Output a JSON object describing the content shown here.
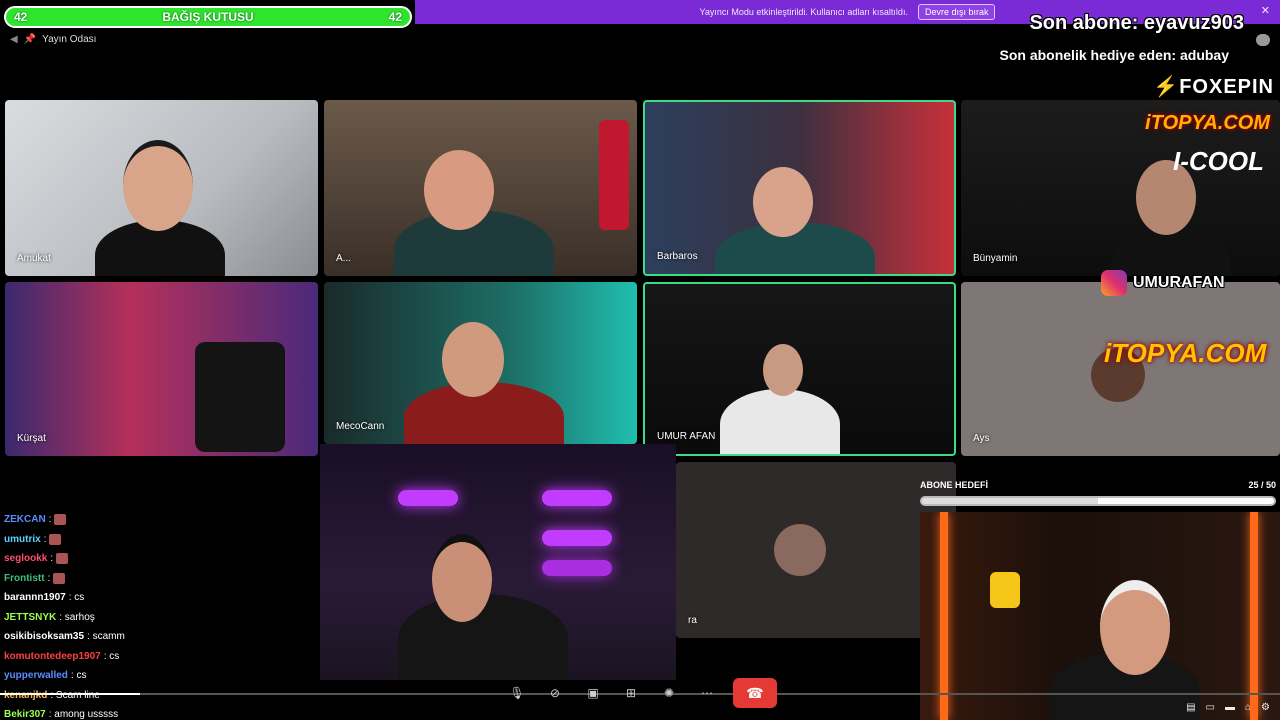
{
  "donation": {
    "left_count": "42",
    "title": "BAĞIŞ KUTUSU",
    "right_count": "42",
    "color": "#2ee52e"
  },
  "banner": {
    "message": "Yayıncı Modu etkinleştirildi. Kullanıcı adları kısaltıldı.",
    "button": "Devre dışı bırak",
    "close": "✕"
  },
  "room": {
    "title": "Yayın Odası",
    "pin_icon": "pin-icon"
  },
  "overlay": {
    "last_sub": "Son abone: eyavuz903",
    "last_gift": "Son abonelik hediye eden: adubay"
  },
  "sponsors": {
    "foxepin": "FOXEPIN",
    "itopya": "iTOPYA.COM",
    "icool": "I-COOL",
    "instagram": "UMURAFAN",
    "itopya2": "iTOPYA.COM"
  },
  "participants": [
    {
      "name": "Amukat"
    },
    {
      "name": "A..."
    },
    {
      "name": "Barbaros"
    },
    {
      "name": "Bünyamin"
    },
    {
      "name": "Kürşat"
    },
    {
      "name": "MecoCann"
    },
    {
      "name": "UMUR AFAN"
    },
    {
      "name": "Ays"
    },
    {
      "name": "ra"
    }
  ],
  "sub_goal": {
    "label": "ABONE HEDEFİ",
    "count": "25 / 50",
    "progress": 0.5
  },
  "chat": [
    {
      "user": "ZEKCAN",
      "text": "",
      "color": "#5b8cff",
      "emote": true
    },
    {
      "user": "umutrix",
      "text": "",
      "color": "#5ad2ff",
      "emote": true
    },
    {
      "user": "seglookk",
      "text": "",
      "color": "#ff4d6d",
      "emote": true
    },
    {
      "user": "Frontistt",
      "text": "",
      "color": "#3bbf7a",
      "emote": true
    },
    {
      "user": "barannn1907",
      "text": ": cs",
      "color": "#ffffff",
      "emote": false
    },
    {
      "user": "JETTSNYK",
      "text": ": sarhoş",
      "color": "#9bff4f",
      "emote": false
    },
    {
      "user": "osikibisoksam35",
      "text": ": scamm",
      "color": "#ffffff",
      "emote": false
    },
    {
      "user": "komutontedeep1907",
      "text": ": cs",
      "color": "#ff4040",
      "emote": false
    },
    {
      "user": "yupperwalled",
      "text": ": cs",
      "color": "#5b8cff",
      "emote": false
    },
    {
      "user": "kenanjkd",
      "text": ": Scam line",
      "color": "#ffb74d",
      "emote": false
    },
    {
      "user": "Bekir307",
      "text": ": among usssss",
      "color": "#9bff4f",
      "emote": false
    }
  ],
  "controls": [
    "mic-icon",
    "camera-off-icon",
    "screen-share-icon",
    "grid-icon",
    "effects-icon",
    "more-icon"
  ],
  "player_icons": [
    "subtitles-icon",
    "miniplayer-icon",
    "theater-icon",
    "cast-icon",
    "settings-icon"
  ]
}
